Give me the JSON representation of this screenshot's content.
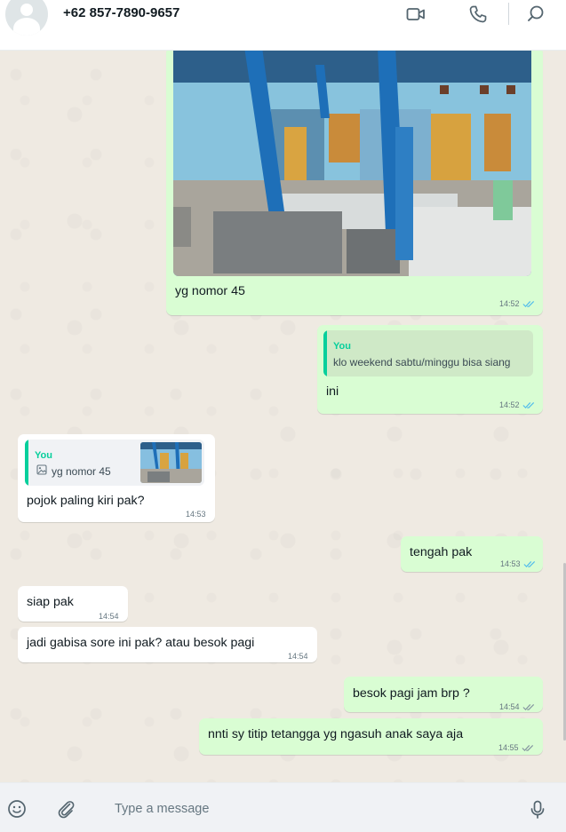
{
  "header": {
    "contact_name": "+62 857-7890-9657",
    "icons": [
      "video-call-icon",
      "voice-call-icon",
      "search-icon"
    ]
  },
  "messages": [
    {
      "id": "m1",
      "direction": "out",
      "type": "image",
      "caption": "yg nomor 45",
      "time": "14:52",
      "status": "read"
    },
    {
      "id": "m2",
      "direction": "out",
      "type": "reply",
      "quote_author": "You",
      "quote_text": "klo weekend sabtu/minggu bisa siang",
      "text": "ini",
      "time": "14:52",
      "status": "read"
    },
    {
      "id": "m3",
      "direction": "in",
      "type": "reply",
      "quote_author": "You",
      "quote_text": "yg nomor 45",
      "quote_has_photo": true,
      "text": "pojok paling kiri pak?",
      "time": "14:53"
    },
    {
      "id": "m4",
      "direction": "out",
      "type": "text",
      "text": "tengah pak",
      "time": "14:53",
      "status": "read"
    },
    {
      "id": "m5",
      "direction": "in",
      "type": "text",
      "text": "siap pak",
      "time": "14:54"
    },
    {
      "id": "m6",
      "direction": "in",
      "type": "text",
      "text": "jadi gabisa sore ini pak? atau besok pagi",
      "time": "14:54"
    },
    {
      "id": "m7",
      "direction": "out",
      "type": "text",
      "text": "besok pagi jam brp ?",
      "time": "14:54",
      "status": "delivered"
    },
    {
      "id": "m8",
      "direction": "out",
      "type": "text",
      "text": "nnti sy titip tetangga yg ngasuh anak saya aja",
      "time": "14:55",
      "status": "delivered"
    }
  ],
  "composer": {
    "placeholder": "Type a message",
    "icons": [
      "emoji-icon",
      "attach-icon",
      "microphone-icon"
    ]
  },
  "colors": {
    "outgoing_bubble": "#d9fdd3",
    "incoming_bubble": "#ffffff",
    "read_ticks": "#53bdeb",
    "delivered_ticks": "#8696a0",
    "quote_accent": "#06cf9c"
  }
}
